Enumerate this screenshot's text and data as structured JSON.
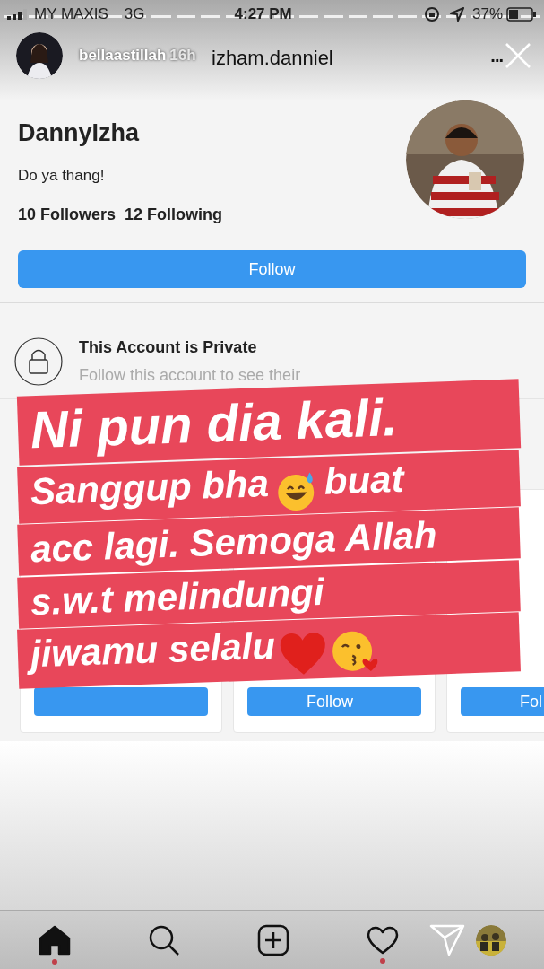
{
  "status_bar": {
    "carrier": "MY MAXIS",
    "network": "3G",
    "time": "4:27 PM",
    "battery": "37%"
  },
  "story": {
    "user": "bellaastillah",
    "age": "16h"
  },
  "profile": {
    "header_title": "izham.danniel",
    "more": "...",
    "name": "DannyIzha",
    "bio": "Do ya thang!",
    "followers": "10 Followers",
    "following": "12 Following",
    "follow_button": "Follow",
    "private_title": "This Account is Private",
    "private_text": "Follow this account to see their"
  },
  "suggestions": [
    {
      "kind": "covered"
    },
    {
      "kind": "card",
      "button": "Follow"
    },
    {
      "kind": "card",
      "button": "Fol"
    }
  ],
  "caption": [
    [
      {
        "kind": "text",
        "text": "Ni pun dia kali."
      }
    ],
    [
      {
        "kind": "text",
        "text": "Sanggup bha"
      },
      {
        "kind": "smile"
      },
      {
        "kind": "text",
        "text": "buat"
      }
    ],
    [
      {
        "kind": "text",
        "text": "acc lagi. Semoga Allah"
      }
    ],
    [
      {
        "kind": "text",
        "text": "s.w.t melindungi"
      }
    ],
    [
      {
        "kind": "text",
        "text": "jiwamu selalu"
      },
      {
        "kind": "heart"
      },
      {
        "kind": "kiss"
      }
    ]
  ],
  "nav": [
    {
      "kind": "home",
      "selected": true,
      "dot": true
    },
    {
      "kind": "search",
      "selected": false,
      "dot": false
    },
    {
      "kind": "add",
      "selected": false,
      "dot": false
    },
    {
      "kind": "heart",
      "selected": false,
      "dot": true
    },
    {
      "kind": "send",
      "selected": false,
      "dot": false
    },
    {
      "kind": "avatar",
      "selected": false,
      "dot": false
    }
  ]
}
